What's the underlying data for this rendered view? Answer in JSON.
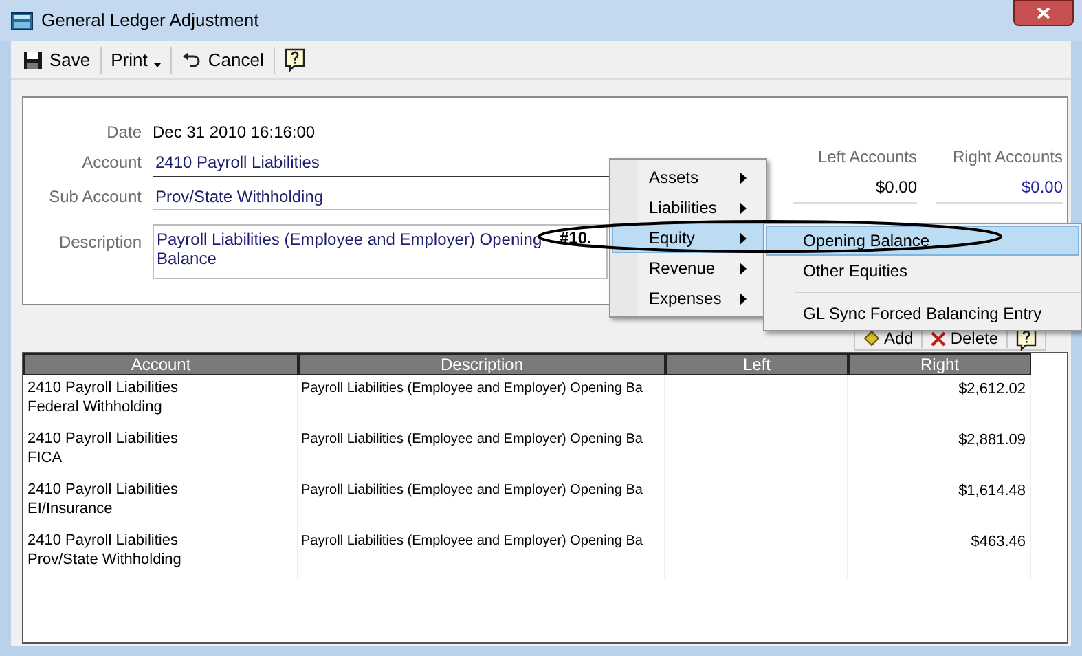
{
  "window": {
    "title": "General Ledger Adjustment"
  },
  "toolbar": [
    {
      "kind": "save",
      "label": "Save"
    },
    {
      "kind": "print",
      "label": "Print"
    },
    {
      "kind": "cancel",
      "label": "Cancel"
    },
    {
      "kind": "help"
    }
  ],
  "form": {
    "date_label": "Date",
    "date": "Dec 31 2010 16:16:00",
    "account_label": "Account",
    "account": "2410 Payroll Liabilities",
    "sub_account_label": "Sub Account",
    "sub_account": "Prov/State Withholding",
    "description_label": "Description",
    "description": "Payroll Liabilities (Employee and Employer) Opening Balance"
  },
  "totals": {
    "columns": [
      "Left Accounts",
      "Right Accounts"
    ],
    "rows": [
      [
        "$0.00",
        "$0.00"
      ]
    ]
  },
  "grid_toolbar": [
    {
      "kind": "add",
      "label": "Add"
    },
    {
      "kind": "delete",
      "label": "Delete"
    },
    {
      "kind": "help"
    }
  ],
  "table": {
    "columns": [
      "Account",
      "Description",
      "Left",
      "Right"
    ],
    "rows": [
      {
        "account": "2410 Payroll Liabilities",
        "sub_account": "Federal Withholding",
        "description": "Payroll Liabilities (Employee and Employer) Opening Ba",
        "right": "$2,612.02"
      },
      {
        "account": "2410 Payroll Liabilities",
        "sub_account": "FICA",
        "description": "Payroll Liabilities (Employee and Employer) Opening Ba",
        "right": "$2,881.09"
      },
      {
        "account": "2410 Payroll Liabilities",
        "sub_account": "EI/Insurance",
        "description": "Payroll Liabilities (Employee and Employer) Opening Ba",
        "right": "$1,614.48"
      },
      {
        "account": "2410 Payroll Liabilities",
        "sub_account": "Prov/State Withholding",
        "description": "Payroll Liabilities (Employee and Employer) Opening Ba",
        "right": "$463.46"
      }
    ]
  },
  "menu": {
    "items": [
      {
        "label": "Assets",
        "selected": false
      },
      {
        "label": "Liabilities",
        "selected": false
      },
      {
        "label": "Equity",
        "selected": true
      },
      {
        "label": "Revenue",
        "selected": false
      },
      {
        "label": "Expenses",
        "selected": false
      }
    ],
    "submenu": [
      {
        "label": "Opening Balance",
        "selected": true
      },
      {
        "label": "Other Equities",
        "selected": false
      },
      {
        "label": "GL Sync Forced Balancing Entry",
        "selected": false
      }
    ]
  },
  "annotation": {
    "label": "#10."
  }
}
